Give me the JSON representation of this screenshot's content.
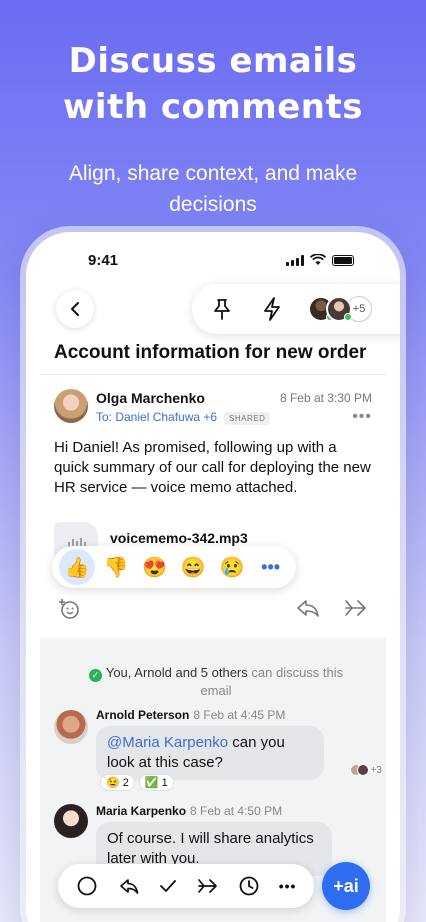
{
  "hero": {
    "title": "Discuss emails\nwith comments",
    "subtitle": "Align, share context, and make decisions"
  },
  "status_bar": {
    "time": "9:41"
  },
  "toolbar": {
    "extra_participants": "+5",
    "icons": [
      "back-icon",
      "pin-icon",
      "bolt-icon"
    ]
  },
  "email": {
    "subject": "Account information for new order",
    "sender": "Olga Marchenko",
    "date": "8 Feb at 3:30 PM",
    "to": "To: Daniel Chafuwa +6",
    "shared_badge": "SHARED",
    "body": "Hi Daniel! As promised, following up with a quick summary of our call for deploying the new HR service — voice memo attached.",
    "attachment": "voicememo-342.mp3"
  },
  "reactions": [
    "👍",
    "👎",
    "😍",
    "😄",
    "😢",
    "•••"
  ],
  "discussion": {
    "note_main": "You, Arnold and 5 others",
    "note_muted": "can discuss this email",
    "comments": [
      {
        "author": "Arnold Peterson",
        "date": "8 Feb at 4:45 PM",
        "mention": "@Maria Karpenko",
        "text": "can you look at this case?",
        "reactions": [
          "😉 2",
          "✅ 1"
        ],
        "seen": "+3"
      },
      {
        "author": "Maria Karpenko",
        "date": "8 Feb at 4:50 PM",
        "text": "Of course. I will share analytics later with you."
      }
    ]
  },
  "bottom_bar": {
    "icons": [
      "circle-icon",
      "reply-all-icon",
      "check-icon",
      "forward-icon",
      "clock-icon",
      "more-icon"
    ],
    "ai_label": "+ai"
  },
  "colors": {
    "accent": "#2f6df0",
    "link": "#3a6fd8",
    "online": "#3bc452"
  }
}
